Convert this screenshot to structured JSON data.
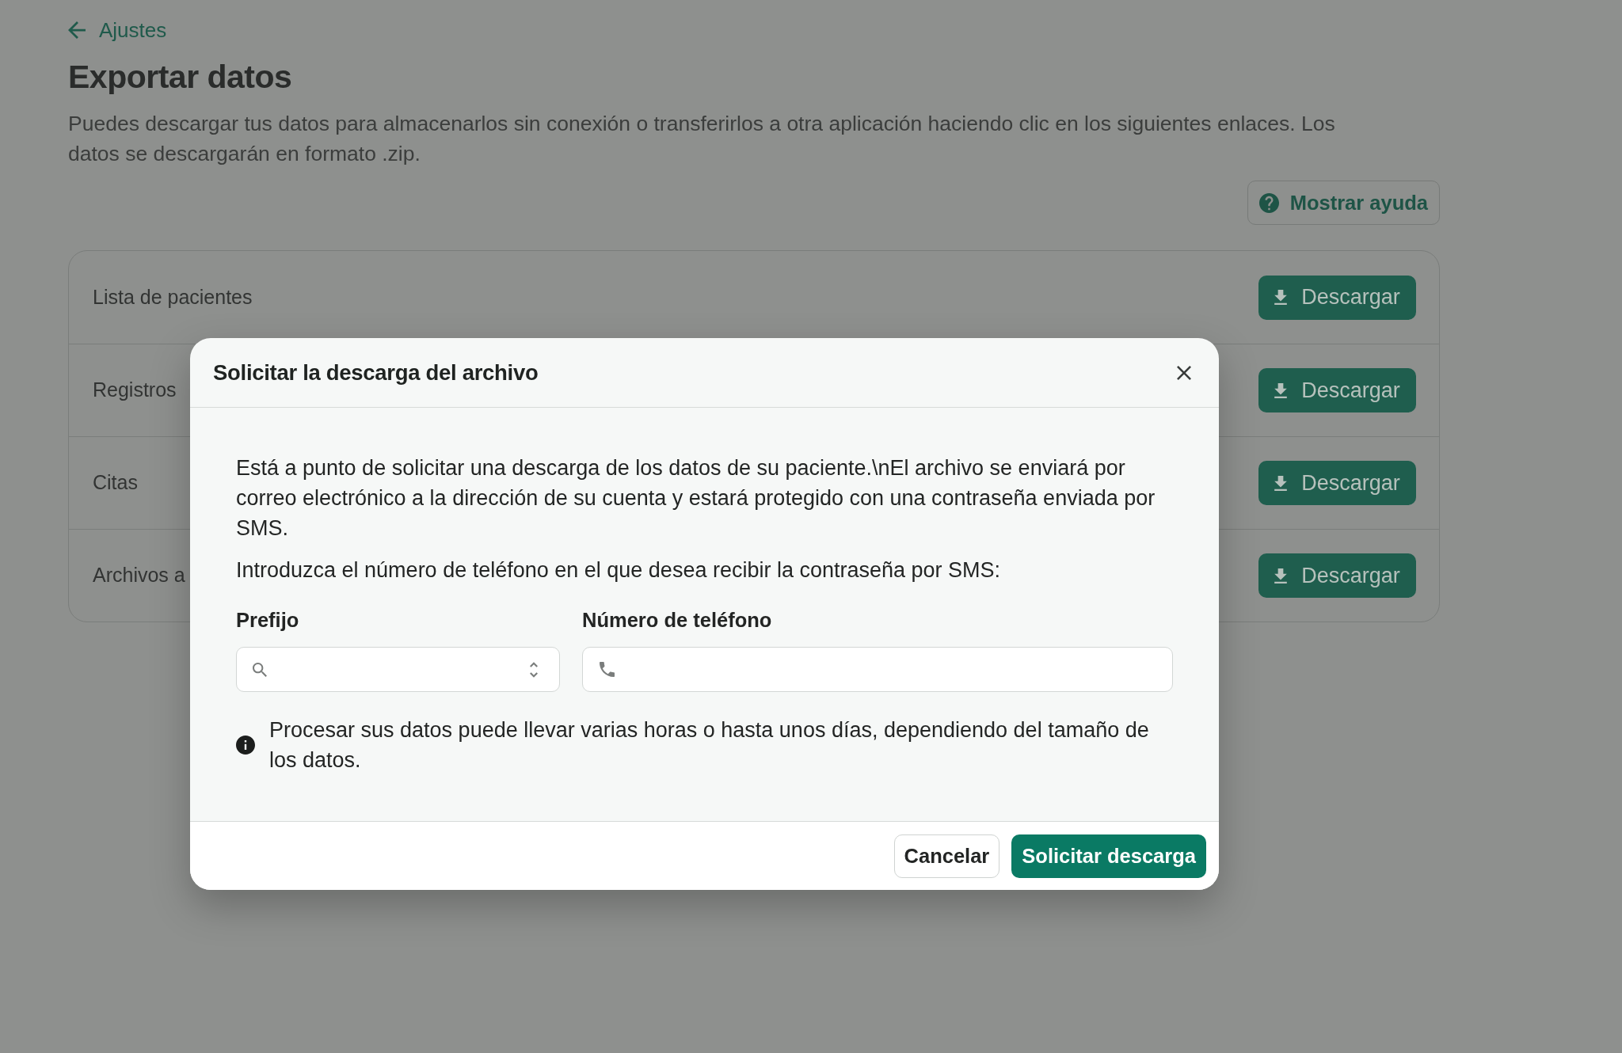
{
  "back_link": {
    "label": "Ajustes"
  },
  "page": {
    "title": "Exportar datos",
    "description": "Puedes descargar tus datos para almacenarlos sin conexión o transferirlos a otra aplicación haciendo clic en los siguientes enlaces. Los datos se descargarán en formato .zip.",
    "help_button": "Mostrar ayuda"
  },
  "exports": [
    {
      "label": "Lista de pacientes",
      "button": "Descargar"
    },
    {
      "label": "Registros",
      "button": "Descargar"
    },
    {
      "label": "Citas",
      "button": "Descargar"
    },
    {
      "label": "Archivos a",
      "button": "Descargar"
    }
  ],
  "dialog": {
    "title": "Solicitar la descarga del archivo",
    "paragraphs": [
      "Está a punto de solicitar una descarga de los datos de su paciente.\\nEl archivo se enviará por correo electrónico a la dirección de su cuenta y estará protegido con una contraseña enviada por SMS.",
      "Introduzca el número de teléfono en el que desea recibir la contraseña por SMS:"
    ],
    "fields": [
      {
        "kind": "select",
        "label": "Prefijo"
      },
      {
        "kind": "phone",
        "label": "Número de teléfono"
      }
    ],
    "note": "Procesar sus datos puede llevar varias horas o hasta unos días, dependiendo del tamaño de los datos.",
    "buttons": [
      {
        "kind": "secondary",
        "label": "Cancelar"
      },
      {
        "kind": "primary",
        "label": "Solicitar descarga"
      }
    ]
  }
}
